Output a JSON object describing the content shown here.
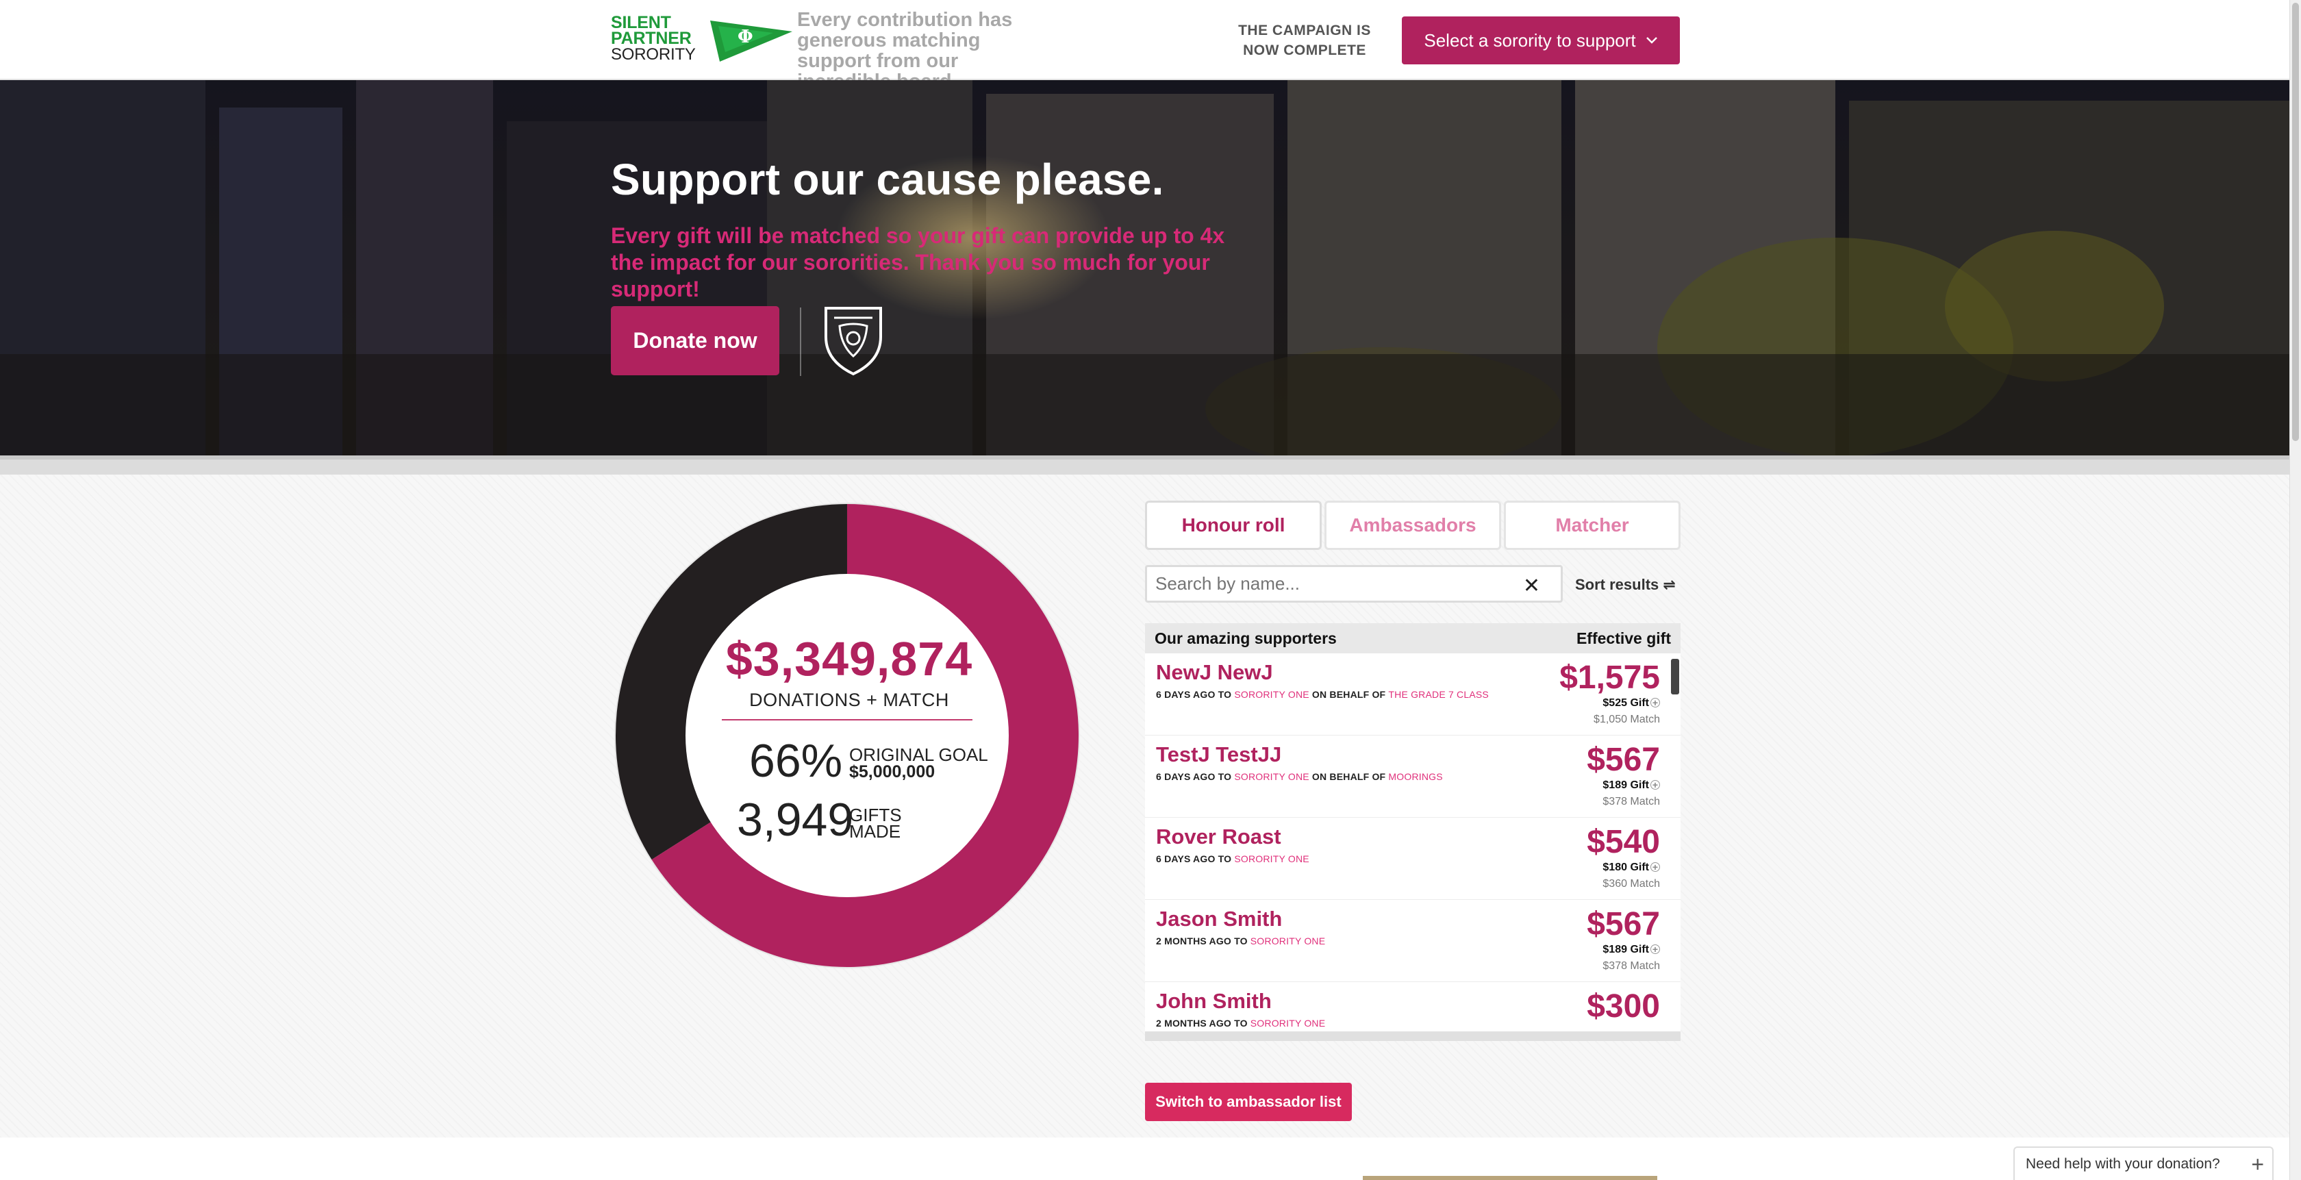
{
  "header": {
    "logo": {
      "line1": "SILENT",
      "line2": "PARTNER",
      "line3": "SORORITY",
      "symbol": "Φ"
    },
    "tagline": "Every contribution has generous matching support from our incredible board",
    "campaign_status": "THE CAMPAIGN IS NOW COMPLETE",
    "select_label": "Select a sorority to support"
  },
  "hero": {
    "title": "Support our cause please.",
    "subtitle": "Every gift will be matched so your gift can provide up to 4x the impact for our sororities. Thank you so much for your support!",
    "donate_label": "Donate now",
    "crest_icon": "shield-crest-icon"
  },
  "progress": {
    "amount": "$3,349,874",
    "amount_label": "DONATIONS + MATCH",
    "percent": "66%",
    "goal_label": "ORIGINAL GOAL",
    "goal_value": "$5,000,000",
    "gifts_count": "3,949",
    "gifts_label_1": "GIFTS",
    "gifts_label_2": "MADE",
    "percent_value": 0.66,
    "colors": {
      "filled": "#b0225e",
      "remaining": "#231f20"
    }
  },
  "tabs": [
    {
      "label": "Honour roll",
      "active": true
    },
    {
      "label": "Ambassadors",
      "active": false
    },
    {
      "label": "Matcher",
      "active": false
    }
  ],
  "search": {
    "placeholder": "Search by name...",
    "sort_label": "Sort results ⇌"
  },
  "list": {
    "header_left": "Our amazing supporters",
    "header_right": "Effective gift",
    "rows": [
      {
        "name": "NewJ NewJ",
        "when": "6 DAYS AGO TO ",
        "org": "SORORITY ONE",
        "behalf_prefix": " ON BEHALF OF ",
        "behalf": "THE GRADE 7 CLASS",
        "effective": "$1,575",
        "gift": "$525 Gift",
        "match": "$1,050 Match"
      },
      {
        "name": "TestJ TestJJ",
        "when": "6 DAYS AGO TO ",
        "org": "SORORITY ONE",
        "behalf_prefix": " ON BEHALF OF ",
        "behalf": "MOORINGS",
        "effective": "$567",
        "gift": "$189 Gift",
        "match": "$378 Match"
      },
      {
        "name": "Rover Roast",
        "when": "6 DAYS AGO TO ",
        "org": "SORORITY ONE",
        "behalf_prefix": "",
        "behalf": "",
        "effective": "$540",
        "gift": "$180 Gift",
        "match": "$360 Match"
      },
      {
        "name": "Jason Smith",
        "when": "2 MONTHS AGO TO ",
        "org": "SORORITY ONE",
        "behalf_prefix": "",
        "behalf": "",
        "effective": "$567",
        "gift": "$189 Gift",
        "match": "$378 Match"
      },
      {
        "name": "John Smith",
        "when": "2 MONTHS AGO TO ",
        "org": "SORORITY ONE",
        "behalf_prefix": "",
        "behalf": "",
        "effective": "$300",
        "gift": "",
        "match": ""
      }
    ]
  },
  "switch_label": "Switch to ambassador list",
  "help_label": "Need help with your donation?"
}
